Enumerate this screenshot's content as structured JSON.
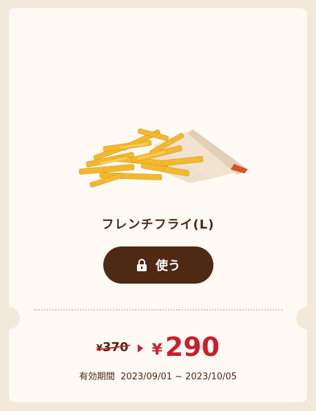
{
  "product": {
    "name": "フレンチフライ(L)",
    "image_icon": "french-fries-image"
  },
  "actions": {
    "use_label": "使う",
    "use_icon": "lock-icon"
  },
  "price": {
    "old_currency": "¥",
    "old_value": "370",
    "new_currency": "¥",
    "new_value": "290",
    "accent_color": "#c8202c"
  },
  "validity": {
    "label": "有効期間",
    "period": "2023/09/01 ~ 2023/10/05"
  },
  "colors": {
    "background": "#f3e9da",
    "card": "#fffbf4",
    "button": "#4e2914",
    "text": "#4a2616"
  }
}
